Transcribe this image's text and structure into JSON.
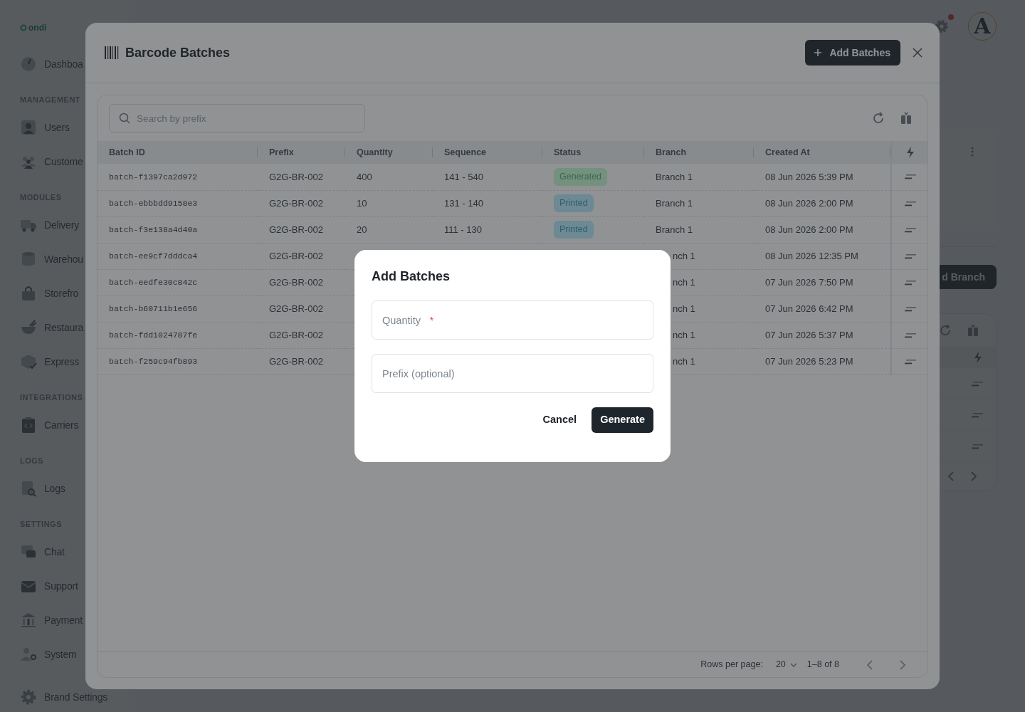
{
  "sidebar": {
    "logo": "ondi",
    "sections": [
      {
        "items": [
          {
            "label": "Dashboa"
          }
        ]
      },
      {
        "heading": "MANAGEMENT",
        "items": [
          {
            "label": "Users"
          },
          {
            "label": "Custome"
          }
        ]
      },
      {
        "heading": "MODULES",
        "items": [
          {
            "label": "Delivery"
          },
          {
            "label": "Warehou"
          },
          {
            "label": "Storefro"
          },
          {
            "label": "Restaura"
          },
          {
            "label": "Express"
          }
        ]
      },
      {
        "heading": "INTEGRATIONS",
        "items": [
          {
            "label": "Carriers"
          }
        ]
      },
      {
        "heading": "LOGS",
        "items": [
          {
            "label": "Logs"
          }
        ]
      },
      {
        "heading": "SETTINGS",
        "items": [
          {
            "label": "Chat"
          },
          {
            "label": "Support"
          },
          {
            "label": "Payment"
          },
          {
            "label": "System"
          },
          {
            "label": "Brand Settings"
          }
        ]
      }
    ]
  },
  "header": {
    "notification": true,
    "avatar_letter": "A"
  },
  "background_page": {
    "add_button": "d Branch"
  },
  "batches_modal": {
    "title": "Barcode Batches",
    "add_button": "Add Batches",
    "search": {
      "placeholder": "Search by prefix"
    },
    "table": {
      "columns": [
        "Batch ID",
        "Prefix",
        "Quantity",
        "Sequence",
        "Status",
        "Branch",
        "Created At"
      ],
      "rows": [
        {
          "batch_id": "batch-f1397ca2d972",
          "prefix": "G2G-BR-002",
          "quantity": "400",
          "sequence": "141 - 540",
          "status": {
            "label": "Generated",
            "color": "#74907f"
          },
          "branch": "Branch 1",
          "created_at": "08 Jun 2026 5:39 PM"
        },
        {
          "batch_id": "batch-ebbbdd9158e3",
          "prefix": "G2G-BR-002",
          "quantity": "10",
          "sequence": "131 - 140",
          "status": {
            "label": "Printed",
            "color": "#6c8994"
          },
          "branch": "Branch 1",
          "created_at": "08 Jun 2026 2:00 PM"
        },
        {
          "batch_id": "batch-f3e138a4d40a",
          "prefix": "G2G-BR-002",
          "quantity": "20",
          "sequence": "111 - 130",
          "status": {
            "label": "Printed",
            "color": "#6c8994"
          },
          "branch": "Branch 1",
          "created_at": "08 Jun 2026 2:00 PM"
        },
        {
          "batch_id": "batch-ee9cf7dddca4",
          "prefix": "G2G-BR-002",
          "branch": "nch 1",
          "created_at": "08 Jun 2026 12:35 PM"
        },
        {
          "batch_id": "batch-eedfe30c842c",
          "prefix": "G2G-BR-002",
          "branch": "nch 1",
          "created_at": "07 Jun 2026 7:50 PM"
        },
        {
          "batch_id": "batch-b60711b1e656",
          "prefix": "G2G-BR-002",
          "branch": "nch 1",
          "created_at": "07 Jun 2026 6:42 PM"
        },
        {
          "batch_id": "batch-fdd1024787fe",
          "prefix": "G2G-BR-002",
          "branch": "nch 1",
          "created_at": "07 Jun 2026 5:37 PM"
        },
        {
          "batch_id": "batch-f259c94fb893",
          "prefix": "G2G-BR-002",
          "branch": "nch 1",
          "created_at": "07 Jun 2026 5:23 PM"
        }
      ]
    },
    "pagination": {
      "rows_per_page_label": "Rows per page:",
      "rows_per_page": "20",
      "range": "1–8 of 8"
    }
  },
  "add_dialog": {
    "title": "Add Batches",
    "fields": [
      {
        "placeholder": "Quantity",
        "required_mark": "*"
      },
      {
        "placeholder": "Prefix (optional)"
      }
    ],
    "buttons": [
      {
        "label": "Cancel",
        "kind": "text"
      },
      {
        "label": "Generate",
        "kind": "primary"
      }
    ]
  }
}
